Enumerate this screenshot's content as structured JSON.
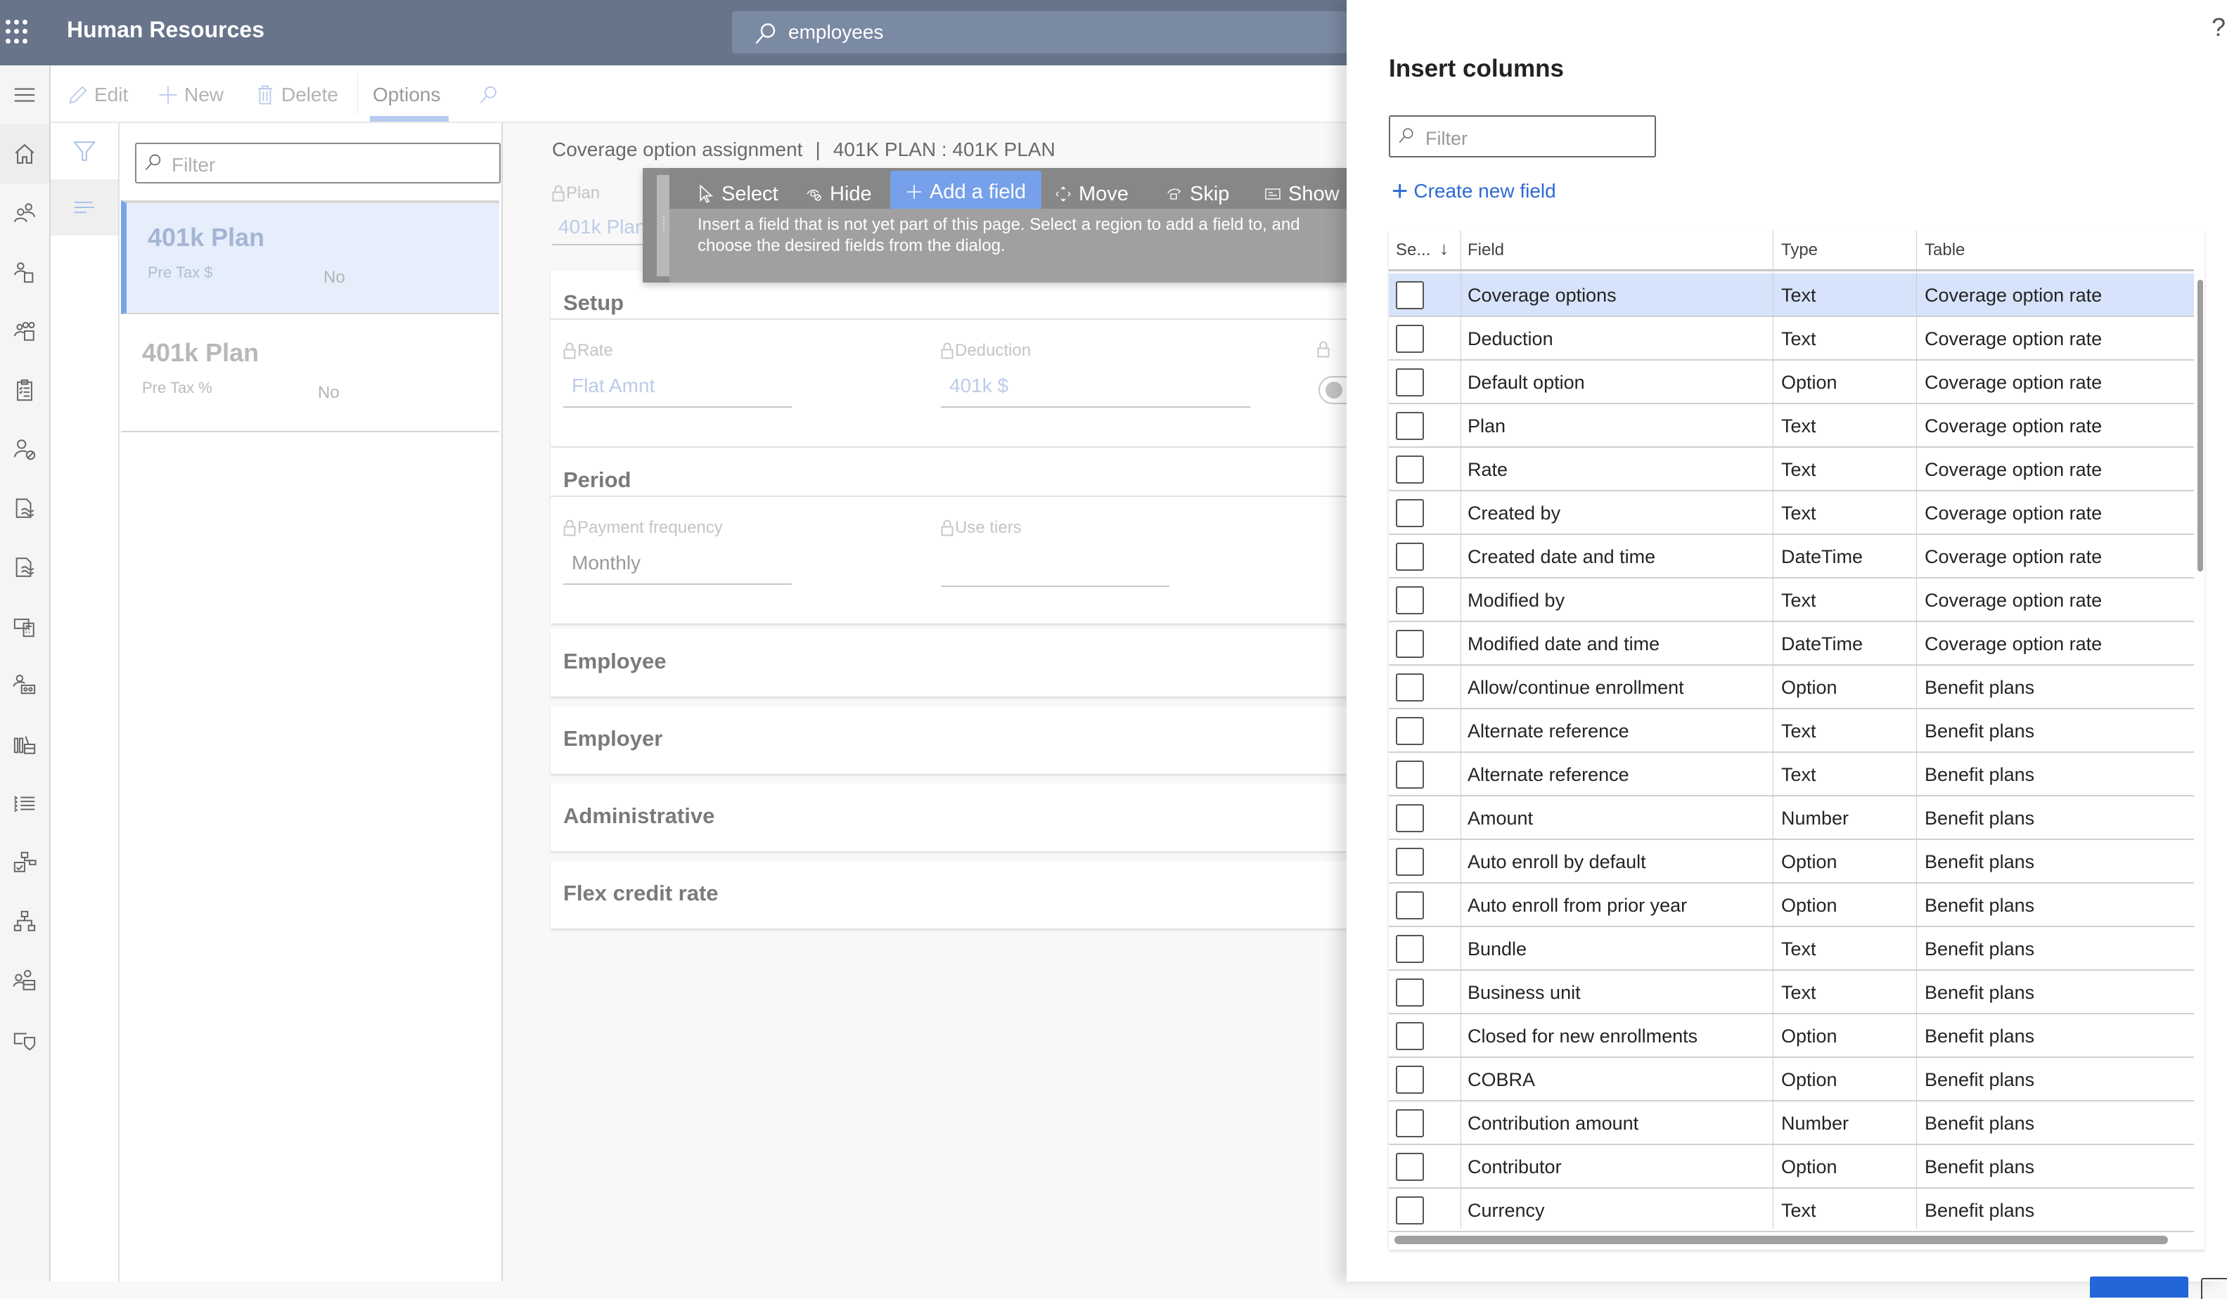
{
  "header": {
    "app_title": "Human Resources",
    "search_value": "employees",
    "colors": {
      "bar": "#67748a",
      "search": "#7b8aa3"
    }
  },
  "left_nav": {
    "items": [
      {
        "icon": "hamburger-icon"
      },
      {
        "icon": "home-icon"
      },
      {
        "icon": "people-icon"
      },
      {
        "icon": "person-document-icon"
      },
      {
        "icon": "team-briefcase-icon"
      },
      {
        "icon": "checklist-icon"
      },
      {
        "icon": "person-blocked-icon"
      },
      {
        "icon": "document-edit-icon"
      },
      {
        "icon": "document-signature-icon"
      },
      {
        "icon": "money-calculator-icon"
      },
      {
        "icon": "person-group-icon"
      },
      {
        "icon": "library-icon"
      },
      {
        "icon": "task-list-icon"
      },
      {
        "icon": "org-approve-icon"
      },
      {
        "icon": "org-chart-icon"
      },
      {
        "icon": "people-workplace-icon"
      },
      {
        "icon": "shield-card-icon"
      }
    ]
  },
  "toolbar": {
    "edit": "Edit",
    "new": "New",
    "delete": "Delete",
    "options": "Options"
  },
  "list": {
    "filter_placeholder": "Filter",
    "items": [
      {
        "title": "401k Plan",
        "subtitle": "Pre Tax $",
        "flag": "No",
        "selected": true
      },
      {
        "title": "401k Plan",
        "subtitle": "Pre Tax %",
        "flag": "No",
        "selected": false
      }
    ]
  },
  "form": {
    "title": "Coverage option assignment",
    "record": "401K PLAN : 401K PLAN",
    "plan_label": "Plan",
    "plan_value": "401k Plan",
    "sections": {
      "setup": "Setup",
      "period": "Period",
      "employee": "Employee",
      "employer": "Employer",
      "administrative": "Administrative",
      "flex": "Flex credit rate"
    },
    "fields": {
      "rate_label": "Rate",
      "rate_value": "Flat Amnt",
      "deduction_label": "Deduction",
      "deduction_value": "401k $",
      "payfreq_label": "Payment frequency",
      "payfreq_value": "Monthly",
      "usetiers_label": "Use tiers",
      "usetiers_value": ""
    }
  },
  "personalize": {
    "tools": {
      "select": "Select",
      "hide": "Hide",
      "add_field": "Add a field",
      "move": "Move",
      "skip": "Skip",
      "show": "Show"
    },
    "active_tool": "add_field",
    "info": "Insert a field that is not yet part of this page. Select a region to add a field to, and choose the desired fields from the dialog.",
    "colors": {
      "active": "#76a0e9"
    }
  },
  "insert_columns": {
    "title": "Insert columns",
    "filter_placeholder": "Filter",
    "create_new_field": "Create new field",
    "columns": {
      "select": "Se...",
      "field": "Field",
      "type": "Type",
      "table": "Table"
    },
    "rows": [
      {
        "field": "Coverage options",
        "type": "Text",
        "table": "Coverage option rate",
        "checked": false,
        "highlighted": true
      },
      {
        "field": "Deduction",
        "type": "Text",
        "table": "Coverage option rate",
        "checked": false
      },
      {
        "field": "Default option",
        "type": "Option",
        "table": "Coverage option rate",
        "checked": false
      },
      {
        "field": "Plan",
        "type": "Text",
        "table": "Coverage option rate",
        "checked": false
      },
      {
        "field": "Rate",
        "type": "Text",
        "table": "Coverage option rate",
        "checked": false
      },
      {
        "field": "Created by",
        "type": "Text",
        "table": "Coverage option rate",
        "checked": false
      },
      {
        "field": "Created date and time",
        "type": "DateTime",
        "table": "Coverage option rate",
        "checked": false
      },
      {
        "field": "Modified by",
        "type": "Text",
        "table": "Coverage option rate",
        "checked": false
      },
      {
        "field": "Modified date and time",
        "type": "DateTime",
        "table": "Coverage option rate",
        "checked": false
      },
      {
        "field": "Allow/continue enrollment",
        "type": "Option",
        "table": "Benefit plans",
        "checked": false
      },
      {
        "field": "Alternate reference",
        "type": "Text",
        "table": "Benefit plans",
        "checked": false
      },
      {
        "field": "Alternate reference",
        "type": "Text",
        "table": "Benefit plans",
        "checked": false
      },
      {
        "field": "Amount",
        "type": "Number",
        "table": "Benefit plans",
        "checked": false
      },
      {
        "field": "Auto enroll by default",
        "type": "Option",
        "table": "Benefit plans",
        "checked": false
      },
      {
        "field": "Auto enroll from prior year",
        "type": "Option",
        "table": "Benefit plans",
        "checked": false
      },
      {
        "field": "Bundle",
        "type": "Text",
        "table": "Benefit plans",
        "checked": false
      },
      {
        "field": "Business unit",
        "type": "Text",
        "table": "Benefit plans",
        "checked": false
      },
      {
        "field": "Closed for new enrollments",
        "type": "Option",
        "table": "Benefit plans",
        "checked": false
      },
      {
        "field": "COBRA",
        "type": "Option",
        "table": "Benefit plans",
        "checked": false
      },
      {
        "field": "Contribution amount",
        "type": "Number",
        "table": "Benefit plans",
        "checked": false
      },
      {
        "field": "Contributor",
        "type": "Option",
        "table": "Benefit plans",
        "checked": false
      },
      {
        "field": "Currency",
        "type": "Text",
        "table": "Benefit plans",
        "checked": false
      }
    ],
    "help_icon": "?",
    "colors": {
      "highlight": "#d6e3fa",
      "link": "#2d6ad4",
      "primary_button": "#2266d9"
    }
  }
}
